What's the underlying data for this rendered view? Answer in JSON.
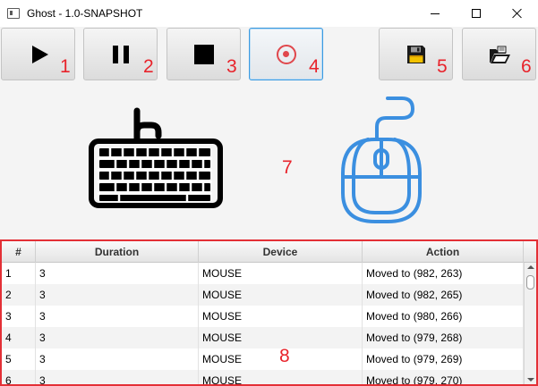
{
  "window": {
    "title": "Ghost - 1.0-SNAPSHOT",
    "icons": {
      "app": "app-window-icon",
      "minimize": "minimize-icon",
      "maximize": "maximize-icon",
      "close": "close-icon"
    }
  },
  "toolbar": {
    "buttons": [
      {
        "icon": "play-icon",
        "marker": "1"
      },
      {
        "icon": "pause-icon",
        "marker": "2"
      },
      {
        "icon": "stop-icon",
        "marker": "3"
      },
      {
        "icon": "record-icon",
        "marker": "4"
      },
      {
        "icon": "save-floppy-icon",
        "marker": "5"
      },
      {
        "icon": "open-folder-icon",
        "marker": "6"
      }
    ]
  },
  "illustration": {
    "keyboard_icon": "keyboard-icon",
    "mouse_icon": "mouse-icon",
    "marker": "7",
    "mouse_color": "#3b8fe0"
  },
  "table": {
    "marker": "8",
    "columns": [
      "#",
      "Duration",
      "Device",
      "Action"
    ],
    "rows": [
      {
        "index": "1",
        "duration": "3",
        "device": "MOUSE",
        "action": "Moved to (982, 263)"
      },
      {
        "index": "2",
        "duration": "3",
        "device": "MOUSE",
        "action": "Moved to (982, 265)"
      },
      {
        "index": "3",
        "duration": "3",
        "device": "MOUSE",
        "action": "Moved to (980, 266)"
      },
      {
        "index": "4",
        "duration": "3",
        "device": "MOUSE",
        "action": "Moved to (979, 268)"
      },
      {
        "index": "5",
        "duration": "3",
        "device": "MOUSE",
        "action": "Moved to (979, 269)"
      },
      {
        "index": "6",
        "duration": "3",
        "device": "MOUSE",
        "action": "Moved to (979, 270)"
      }
    ]
  },
  "colors": {
    "marker_red": "#e8232b",
    "focus_blue": "#3b9ae1",
    "record_red": "#e0474c"
  }
}
